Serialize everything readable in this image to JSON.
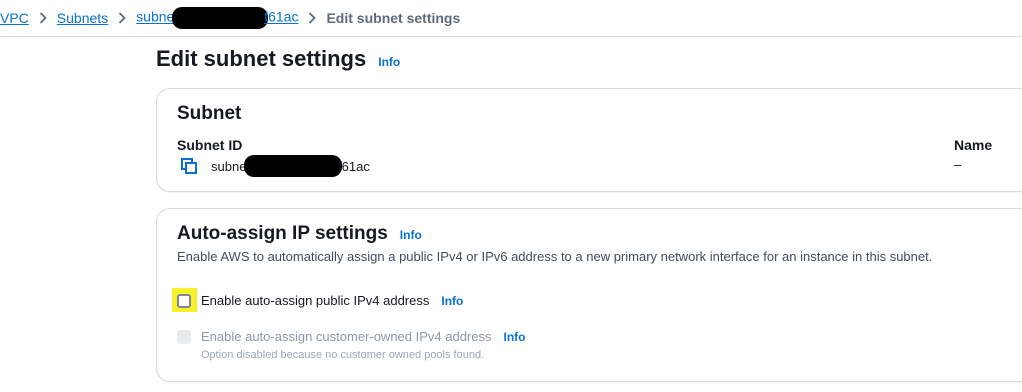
{
  "breadcrumb": {
    "items": [
      "VPC",
      "Subnets",
      "subnet",
      "f61ac"
    ],
    "current": "Edit subnet settings"
  },
  "page": {
    "title": "Edit subnet settings",
    "info": "Info"
  },
  "subnet_card": {
    "title": "Subnet",
    "subnet_id_label": "Subnet ID",
    "subnet_id_prefix": "subnet",
    "subnet_id_suffix": "f61ac",
    "name_label": "Name",
    "name_value": "–",
    "copy_icon": "copy-icon"
  },
  "auto_assign": {
    "title": "Auto-assign IP settings",
    "info": "Info",
    "description": "Enable AWS to automatically assign a public IPv4 or IPv6 address to a new primary network interface for an instance in this subnet.",
    "ipv4_label": "Enable auto-assign public IPv4 address",
    "ipv4_info": "Info",
    "ipv4_checked": false,
    "customer_label": "Enable auto-assign customer-owned IPv4 address",
    "customer_info": "Info",
    "customer_disabled": true,
    "customer_note": "Option disabled because no customer owned pools found."
  },
  "colors": {
    "link": "#0972d3",
    "highlight": "#f8f02a"
  }
}
